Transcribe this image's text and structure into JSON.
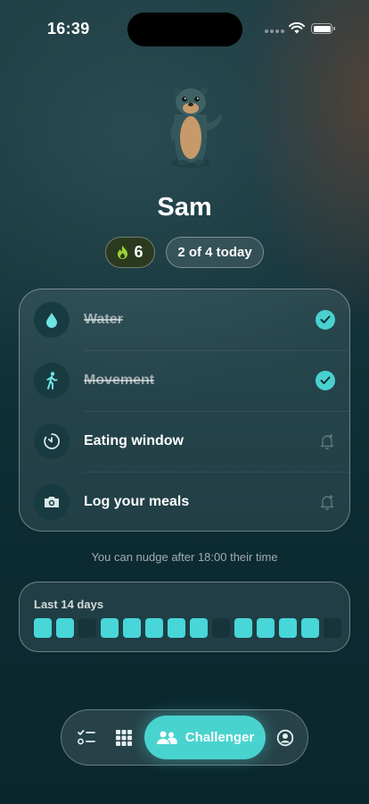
{
  "status_bar": {
    "time": "16:39"
  },
  "profile": {
    "name": "Sam",
    "streak_count": "6",
    "today_progress": "2 of 4 today"
  },
  "tasks": [
    {
      "label": "Water",
      "icon": "water-drop-icon",
      "completed": true
    },
    {
      "label": "Movement",
      "icon": "walking-person-icon",
      "completed": true
    },
    {
      "label": "Eating window",
      "icon": "timer-icon",
      "completed": false
    },
    {
      "label": "Log your meals",
      "icon": "camera-icon",
      "completed": false
    }
  ],
  "nudge_note": "You can nudge after 18:00 their time",
  "history": {
    "title": "Last 14 days",
    "days": [
      true,
      true,
      false,
      true,
      true,
      true,
      true,
      true,
      false,
      true,
      true,
      true,
      true,
      false
    ]
  },
  "tab_bar": {
    "tabs": [
      {
        "icon": "checklist-icon",
        "active": false
      },
      {
        "icon": "grid-icon",
        "active": false
      },
      {
        "icon": "people-icon",
        "label": "Challenger",
        "active": true
      },
      {
        "icon": "profile-icon",
        "active": false
      }
    ]
  },
  "colors": {
    "accent": "#49d3cf",
    "streak_flame": "#9bd13a",
    "background": "#123138"
  }
}
